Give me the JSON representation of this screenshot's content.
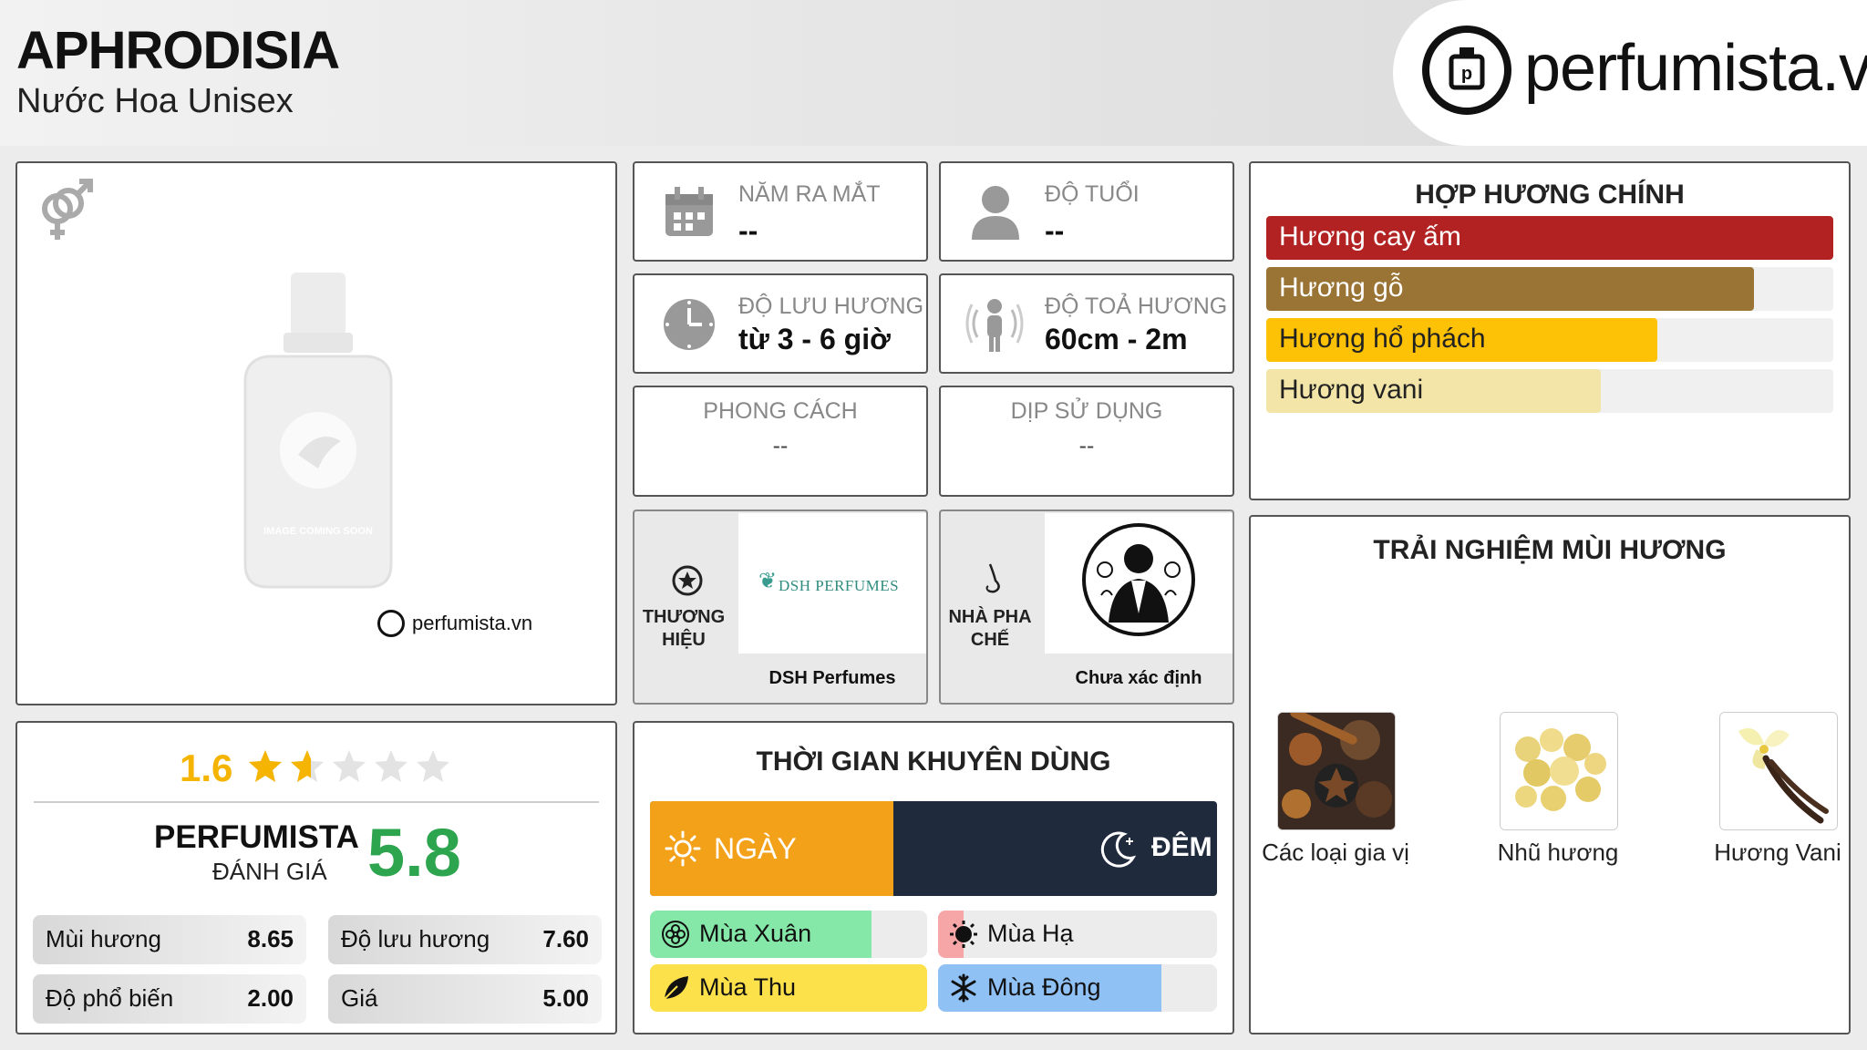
{
  "product": {
    "name": "APHRODISIA",
    "subtitle": "Nước Hoa Unisex"
  },
  "brand_site": "perfumista.vn",
  "image_panel": {
    "gender_icon": "unisex-gender-icon",
    "placeholder_text": "IMAGE COMING SOON",
    "watermark": "perfumista.vn"
  },
  "info": {
    "release_year": {
      "label": "NĂM RA MẮT",
      "value": "--"
    },
    "age": {
      "label": "ĐỘ TUỔI",
      "value": "--"
    },
    "longevity": {
      "label": "ĐỘ LƯU HƯƠNG",
      "value": "từ 3 - 6 giờ"
    },
    "sillage": {
      "label": "ĐỘ TOẢ HƯƠNG",
      "value": "60cm - 2m"
    },
    "style": {
      "label": "PHONG CÁCH",
      "value": "--"
    },
    "occasion": {
      "label": "DỊP SỬ DỤNG",
      "value": "--"
    }
  },
  "brand": {
    "label": "THƯƠNG HIỆU",
    "logo_text": "DSH PERFUMES",
    "name": "DSH Perfumes"
  },
  "perfumer": {
    "label": "NHÀ PHA CHẾ",
    "name": "Chưa xác định"
  },
  "accords": {
    "title": "HỢP HƯƠNG CHÍNH",
    "items": [
      {
        "label": "Hương cay ấm",
        "fraction": 1.0,
        "color": "#b22222",
        "text_color": "#ffffff"
      },
      {
        "label": "Hương gỗ",
        "fraction": 0.86,
        "color": "#9a7434",
        "text_color": "#ffffff"
      },
      {
        "label": "Hương hổ phách",
        "fraction": 0.69,
        "color": "#fdc106",
        "text_color": "#222222"
      },
      {
        "label": "Hương vani",
        "fraction": 0.59,
        "color": "#f3e5a8",
        "text_color": "#222222"
      }
    ]
  },
  "experience": {
    "title": "TRẢI NGHIỆM MÙI HƯƠNG",
    "notes": [
      {
        "label": "Các loại gia vị",
        "icon": "spices-image"
      },
      {
        "label": "Nhũ hương",
        "icon": "frankincense-image"
      },
      {
        "label": "Hương Vani",
        "icon": "vanilla-image"
      }
    ]
  },
  "rating": {
    "community_score": "1.6",
    "community_stars": 1.6,
    "perfumista_label": "PERFUMISTA",
    "perfumista_sub": "ĐÁNH GIÁ",
    "perfumista_score": "5.8",
    "scores": [
      {
        "label": "Mùi hương",
        "value": "8.65"
      },
      {
        "label": "Độ lưu hương",
        "value": "7.60"
      },
      {
        "label": "Độ phổ biến",
        "value": "2.00"
      },
      {
        "label": "Giá",
        "value": "5.00"
      }
    ]
  },
  "recommended_time": {
    "title": "THỜI GIAN KHUYÊN DÙNG",
    "day_label": "NGÀY",
    "night_label": "ĐÊM",
    "day_fraction": 0.43,
    "day_color": "#f4a11a",
    "night_color": "#1f2a3c",
    "seasons": [
      {
        "label": "Mùa Xuân",
        "fraction": 0.8,
        "color": "#86e8a8",
        "icon": "flower-icon"
      },
      {
        "label": "Mùa Hạ",
        "fraction": 0.09,
        "color": "#f6a6a6",
        "icon": "sun-icon"
      },
      {
        "label": "Mùa Thu",
        "fraction": 1.0,
        "color": "#fce14b",
        "icon": "leaf-icon"
      },
      {
        "label": "Mùa Đông",
        "fraction": 0.8,
        "color": "#8fc1f5",
        "icon": "snowflake-icon"
      }
    ]
  }
}
